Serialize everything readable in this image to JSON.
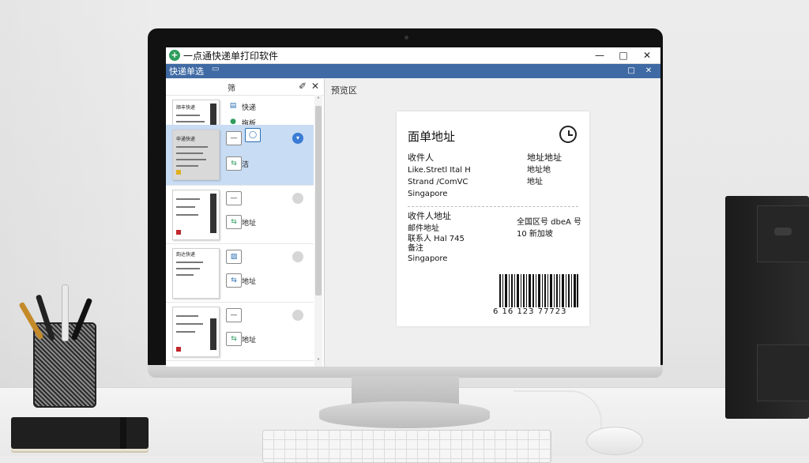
{
  "window": {
    "title": "一点通快递单打印软件",
    "minimize": "—",
    "maximize": "□",
    "close": "✕"
  },
  "menubar": {
    "title": "快递单选",
    "window_icon": "▭",
    "restore": "□",
    "close": "✕"
  },
  "left_panel": {
    "header_label": "筛",
    "pin_icon": "pin-icon",
    "close": "✕",
    "scroll_up": "˄",
    "scroll_down": "˅",
    "rows": [
      {
        "thumb_title": "顺丰快递",
        "item1_label": "快递",
        "item2_label": "拖板"
      },
      {
        "thumb_title": "申通快递",
        "item1_label": "",
        "item2_label": "洁"
      },
      {
        "thumb_title": "",
        "item1_label": "",
        "item2_label": "地址"
      },
      {
        "thumb_title": "韵达快递",
        "item1_label": "",
        "item2_label": "地址"
      },
      {
        "thumb_title": "",
        "item1_label": "",
        "item2_label": "地址"
      }
    ]
  },
  "preview": {
    "label": "预览区",
    "card": {
      "title": "面单地址",
      "sender_heading": "收件人",
      "sender_lines": [
        "Like.Stretl Ital H",
        "Strand /ComVC",
        "Singapore"
      ],
      "sender_right": [
        "地址地址",
        "地址地",
        "地址"
      ],
      "receiver_heading": "收件人地址",
      "receiver_lines": [
        "邮件地址",
        "联系人 Hal 745",
        "备注",
        "Singapore"
      ],
      "receiver_right": [
        "全国区号 dbeA 号",
        "10 新加坡"
      ],
      "barcode_number": "6 16 123 77723"
    }
  }
}
